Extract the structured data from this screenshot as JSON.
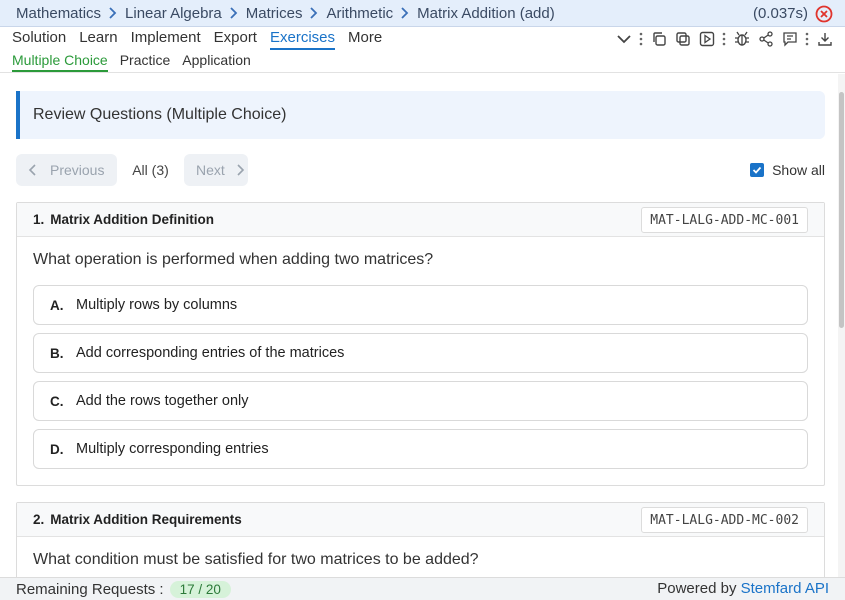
{
  "breadcrumb": [
    "Mathematics",
    "Linear Algebra",
    "Matrices",
    "Arithmetic",
    "Matrix Addition (add)"
  ],
  "timing": "(0.037s)",
  "tabs": [
    "Solution",
    "Learn",
    "Implement",
    "Export",
    "Exercises",
    "More"
  ],
  "active_tab": "Exercises",
  "toolbar_icons": [
    "chevron-down-icon",
    "more-vertical-icon",
    "copy-icon",
    "duplicate-icon",
    "play-icon",
    "more-vertical-icon",
    "bug-icon",
    "share-icon",
    "comment-icon",
    "more-vertical-icon",
    "download-icon"
  ],
  "subtabs": [
    "Multiple Choice",
    "Practice",
    "Application"
  ],
  "active_subtab": "Multiple Choice",
  "review_header": "Review Questions (Multiple Choice)",
  "pager": {
    "previous": "Previous",
    "count": "All (3)",
    "next": "Next"
  },
  "show_all": {
    "label": "Show all",
    "checked": true
  },
  "questions": [
    {
      "number": "1.",
      "title": "Matrix Addition Definition",
      "code": "MAT-LALG-ADD-MC-001",
      "text": "What operation is performed when adding two matrices?",
      "options": [
        {
          "letter": "A.",
          "text": "Multiply rows by columns"
        },
        {
          "letter": "B.",
          "text": "Add corresponding entries of the matrices"
        },
        {
          "letter": "C.",
          "text": "Add the rows together only"
        },
        {
          "letter": "D.",
          "text": "Multiply corresponding entries"
        }
      ]
    },
    {
      "number": "2.",
      "title": "Matrix Addition Requirements",
      "code": "MAT-LALG-ADD-MC-002",
      "text": "What condition must be satisfied for two matrices to be added?"
    }
  ],
  "footer": {
    "remaining_label": "Remaining Requests :",
    "remaining_value": "17 / 20",
    "powered_by": "Powered by",
    "brand": "Stemfard API"
  },
  "colors": {
    "accent": "#1a73c8",
    "success": "#2b9a3a",
    "close": "#e0342d"
  }
}
